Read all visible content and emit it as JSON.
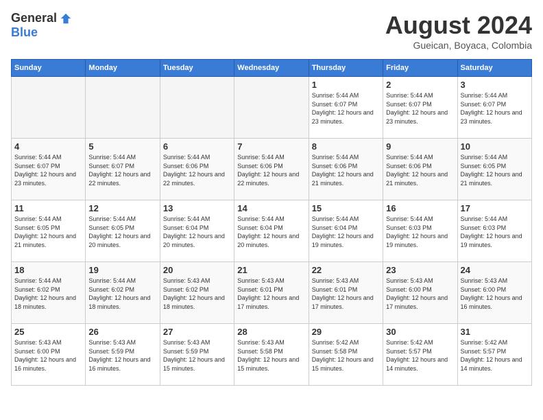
{
  "header": {
    "logo_general": "General",
    "logo_blue": "Blue",
    "title": "August 2024",
    "subtitle": "Gueican, Boyaca, Colombia"
  },
  "days_of_week": [
    "Sunday",
    "Monday",
    "Tuesday",
    "Wednesday",
    "Thursday",
    "Friday",
    "Saturday"
  ],
  "weeks": [
    [
      {
        "day": "",
        "empty": true
      },
      {
        "day": "",
        "empty": true
      },
      {
        "day": "",
        "empty": true
      },
      {
        "day": "",
        "empty": true
      },
      {
        "day": "1",
        "sunrise": "5:44 AM",
        "sunset": "6:07 PM",
        "daylight": "12 hours and 23 minutes."
      },
      {
        "day": "2",
        "sunrise": "5:44 AM",
        "sunset": "6:07 PM",
        "daylight": "12 hours and 23 minutes."
      },
      {
        "day": "3",
        "sunrise": "5:44 AM",
        "sunset": "6:07 PM",
        "daylight": "12 hours and 23 minutes."
      }
    ],
    [
      {
        "day": "4",
        "sunrise": "5:44 AM",
        "sunset": "6:07 PM",
        "daylight": "12 hours and 23 minutes."
      },
      {
        "day": "5",
        "sunrise": "5:44 AM",
        "sunset": "6:07 PM",
        "daylight": "12 hours and 22 minutes."
      },
      {
        "day": "6",
        "sunrise": "5:44 AM",
        "sunset": "6:06 PM",
        "daylight": "12 hours and 22 minutes."
      },
      {
        "day": "7",
        "sunrise": "5:44 AM",
        "sunset": "6:06 PM",
        "daylight": "12 hours and 22 minutes."
      },
      {
        "day": "8",
        "sunrise": "5:44 AM",
        "sunset": "6:06 PM",
        "daylight": "12 hours and 21 minutes."
      },
      {
        "day": "9",
        "sunrise": "5:44 AM",
        "sunset": "6:06 PM",
        "daylight": "12 hours and 21 minutes."
      },
      {
        "day": "10",
        "sunrise": "5:44 AM",
        "sunset": "6:05 PM",
        "daylight": "12 hours and 21 minutes."
      }
    ],
    [
      {
        "day": "11",
        "sunrise": "5:44 AM",
        "sunset": "6:05 PM",
        "daylight": "12 hours and 21 minutes."
      },
      {
        "day": "12",
        "sunrise": "5:44 AM",
        "sunset": "6:05 PM",
        "daylight": "12 hours and 20 minutes."
      },
      {
        "day": "13",
        "sunrise": "5:44 AM",
        "sunset": "6:04 PM",
        "daylight": "12 hours and 20 minutes."
      },
      {
        "day": "14",
        "sunrise": "5:44 AM",
        "sunset": "6:04 PM",
        "daylight": "12 hours and 20 minutes."
      },
      {
        "day": "15",
        "sunrise": "5:44 AM",
        "sunset": "6:04 PM",
        "daylight": "12 hours and 19 minutes."
      },
      {
        "day": "16",
        "sunrise": "5:44 AM",
        "sunset": "6:03 PM",
        "daylight": "12 hours and 19 minutes."
      },
      {
        "day": "17",
        "sunrise": "5:44 AM",
        "sunset": "6:03 PM",
        "daylight": "12 hours and 19 minutes."
      }
    ],
    [
      {
        "day": "18",
        "sunrise": "5:44 AM",
        "sunset": "6:02 PM",
        "daylight": "12 hours and 18 minutes."
      },
      {
        "day": "19",
        "sunrise": "5:44 AM",
        "sunset": "6:02 PM",
        "daylight": "12 hours and 18 minutes."
      },
      {
        "day": "20",
        "sunrise": "5:43 AM",
        "sunset": "6:02 PM",
        "daylight": "12 hours and 18 minutes."
      },
      {
        "day": "21",
        "sunrise": "5:43 AM",
        "sunset": "6:01 PM",
        "daylight": "12 hours and 17 minutes."
      },
      {
        "day": "22",
        "sunrise": "5:43 AM",
        "sunset": "6:01 PM",
        "daylight": "12 hours and 17 minutes."
      },
      {
        "day": "23",
        "sunrise": "5:43 AM",
        "sunset": "6:00 PM",
        "daylight": "12 hours and 17 minutes."
      },
      {
        "day": "24",
        "sunrise": "5:43 AM",
        "sunset": "6:00 PM",
        "daylight": "12 hours and 16 minutes."
      }
    ],
    [
      {
        "day": "25",
        "sunrise": "5:43 AM",
        "sunset": "6:00 PM",
        "daylight": "12 hours and 16 minutes."
      },
      {
        "day": "26",
        "sunrise": "5:43 AM",
        "sunset": "5:59 PM",
        "daylight": "12 hours and 16 minutes."
      },
      {
        "day": "27",
        "sunrise": "5:43 AM",
        "sunset": "5:59 PM",
        "daylight": "12 hours and 15 minutes."
      },
      {
        "day": "28",
        "sunrise": "5:43 AM",
        "sunset": "5:58 PM",
        "daylight": "12 hours and 15 minutes."
      },
      {
        "day": "29",
        "sunrise": "5:42 AM",
        "sunset": "5:58 PM",
        "daylight": "12 hours and 15 minutes."
      },
      {
        "day": "30",
        "sunrise": "5:42 AM",
        "sunset": "5:57 PM",
        "daylight": "12 hours and 14 minutes."
      },
      {
        "day": "31",
        "sunrise": "5:42 AM",
        "sunset": "5:57 PM",
        "daylight": "12 hours and 14 minutes."
      }
    ]
  ]
}
